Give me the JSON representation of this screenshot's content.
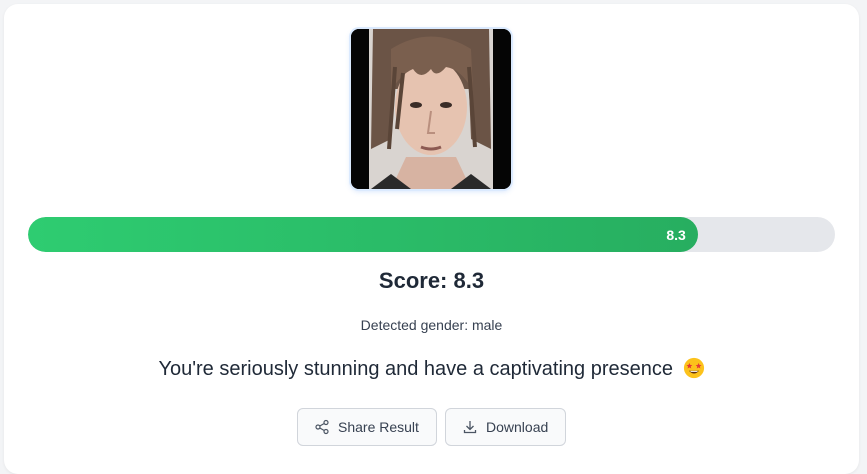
{
  "result": {
    "score_value": 8.3,
    "score_max": 10,
    "progress_fraction": 0.83,
    "progress_label": "8.3",
    "score_title": "Score: 8.3",
    "gender_text": "Detected gender: male",
    "message": "You're seriously stunning and have a captivating presence",
    "message_emoji": "star-struck-emoji"
  },
  "photo": {
    "icon": "user-photo"
  },
  "actions": {
    "share_label": "Share Result",
    "share_icon": "share-icon",
    "download_label": "Download",
    "download_icon": "download-icon"
  },
  "colors": {
    "progress_start": "#2ecc71",
    "progress_end": "#27ae60",
    "track": "#e5e7eb"
  }
}
